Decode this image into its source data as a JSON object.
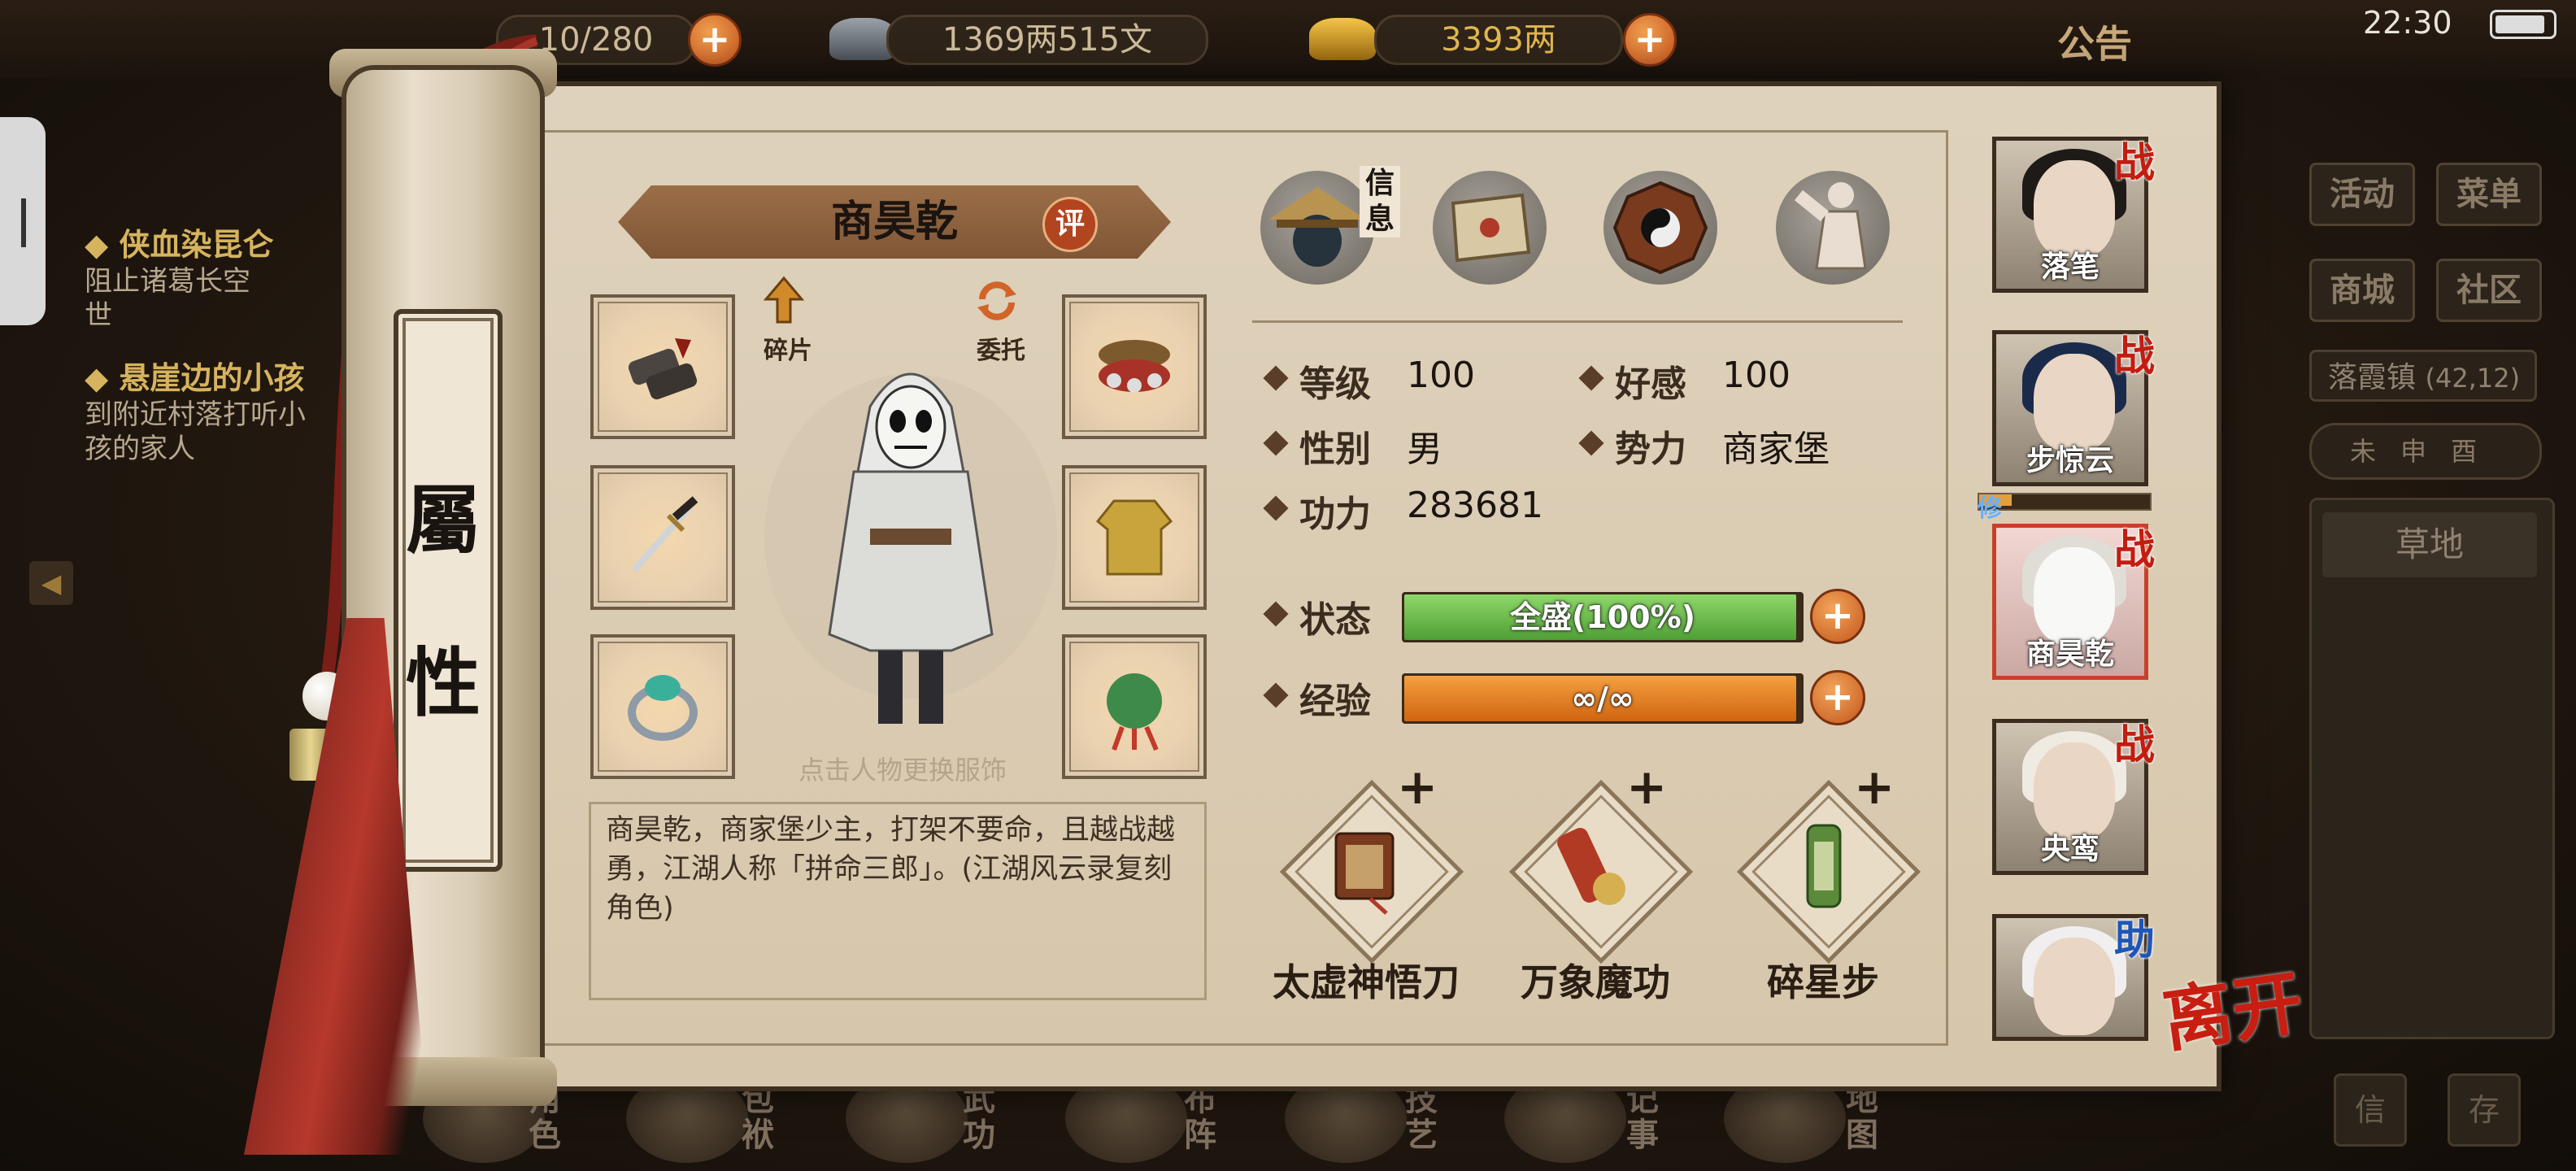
{
  "top_bar": {
    "stamina": "10/280",
    "silver": "1369两515文",
    "gold": "3393两",
    "notice_label": "公告",
    "clock": "22:30"
  },
  "quests": [
    {
      "title": "侠血染昆仑",
      "desc_line1": "阻止诸葛长空",
      "desc_line2": "世"
    },
    {
      "title": "悬崖边的小孩",
      "desc_line1": "到附近村落打听小",
      "desc_line2": "孩的家人"
    }
  ],
  "right_menu": {
    "activity": "活动",
    "menu": "菜单",
    "shop": "商城",
    "community": "社区",
    "location": "落霞镇",
    "coords": "(42,12)",
    "time_marks": "未申酉",
    "terrain": "草地",
    "btn_a": "信",
    "btn_b": "存"
  },
  "bottom_nav": [
    "角色",
    "包袱",
    "武功",
    "布阵",
    "技艺",
    "记事",
    "地图"
  ],
  "panel": {
    "tab_label": "属性",
    "tab_label_top": "屬",
    "tab_label_bottom": "性",
    "character_name": "商昊乾",
    "rate_label": "评",
    "fragment_label": "碎片",
    "entrust_label": "委托",
    "change_outfit_hint": "点击人物更换服饰",
    "bio": "商昊乾，商家堡少主，打架不要命，且越战越勇，江湖人称「拼命三郎」。(江湖风云录复刻角色)",
    "info_tab_label": "信息",
    "stats": {
      "level_label": "等级",
      "level": "100",
      "favor_label": "好感",
      "favor": "100",
      "gender_label": "性别",
      "gender": "男",
      "faction_label": "势力",
      "faction": "商家堡",
      "power_label": "功力",
      "power": "283681"
    },
    "status": {
      "label": "状态",
      "text": "全盛(100%)",
      "fraction": 1.0,
      "color": "#5fb845"
    },
    "exp": {
      "label": "经验",
      "text": "∞/∞",
      "fraction": 1.0,
      "color": "#e27a22"
    },
    "skills": [
      {
        "name": "太虚神悟刀",
        "icon": "scroll-book-icon"
      },
      {
        "name": "万象魔功",
        "icon": "red-scroll-icon"
      },
      {
        "name": "碎星步",
        "icon": "green-scroll-icon"
      }
    ],
    "leave_label": "离开"
  },
  "party": [
    {
      "name": "落笔",
      "badge": "战"
    },
    {
      "name": "步惊云",
      "badge": "战",
      "extra": "修"
    },
    {
      "name": "商昊乾",
      "badge": "战",
      "active": true
    },
    {
      "name": "央鸾",
      "badge": "战"
    },
    {
      "name": "",
      "badge": "助"
    }
  ]
}
